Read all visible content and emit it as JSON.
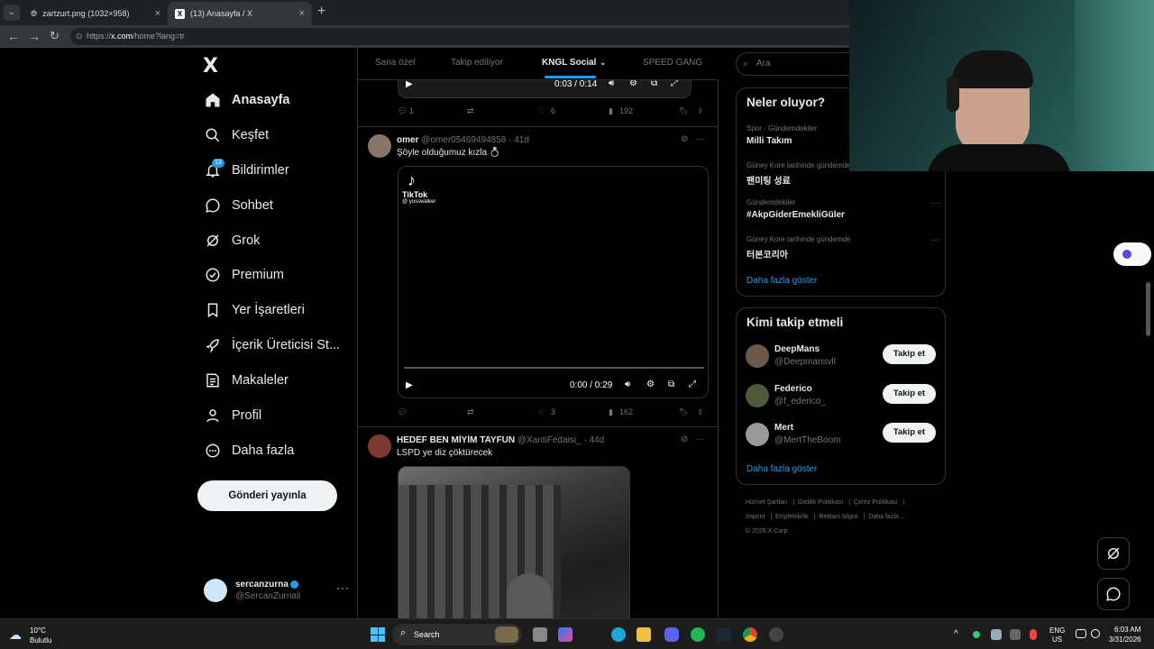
{
  "browser": {
    "tabs": [
      {
        "title": "zartzurt.png (1032×958)",
        "close": "×"
      },
      {
        "title": "(13) Anasayfa / X",
        "close": "×"
      }
    ],
    "new_tab": "+",
    "url_prefix": "https://",
    "url_host": "x.com",
    "url_path": "/home?lang=tr"
  },
  "sidebar": {
    "logo": "X",
    "items": [
      {
        "label": "Anasayfa",
        "icon": "home-icon"
      },
      {
        "label": "Keşfet",
        "icon": "search-icon"
      },
      {
        "label": "Bildirimler",
        "icon": "bell-icon"
      },
      {
        "label": "Sohbet",
        "icon": "chat-icon"
      },
      {
        "label": "Grok",
        "icon": "grok-icon"
      },
      {
        "label": "Premium",
        "icon": "premium-icon"
      },
      {
        "label": "Yer İşaretleri",
        "icon": "bookmark-icon"
      },
      {
        "label": "İçerik Üreticisi St...",
        "icon": "rocket-icon"
      },
      {
        "label": "Makaleler",
        "icon": "article-icon"
      },
      {
        "label": "Profil",
        "icon": "profile-icon"
      },
      {
        "label": "Daha fazla",
        "icon": "more-circle-icon"
      }
    ],
    "notification_count": "13",
    "post_button": "Gönderi yayınla",
    "account": {
      "name": "sercanzurna",
      "handle": "@SercanZurnali",
      "more": "···"
    }
  },
  "feed": {
    "tabs": [
      {
        "label": "Sana özel"
      },
      {
        "label": "Takip ediliyor"
      },
      {
        "label": "KNGL Social",
        "active": true
      },
      {
        "label": "SPEED GANG"
      }
    ],
    "top_video": {
      "time": "0:03 / 0:14"
    },
    "top_actions": {
      "replies": "1",
      "retweets": "",
      "likes": "6",
      "views": "192"
    },
    "tweets": [
      {
        "name": "omer",
        "handle": "@omer05469494858",
        "age": "· 41d",
        "text": "Şöyle olduğumuz kızla 💍",
        "video": {
          "time": "0:00 / 0:29",
          "watermark": "TikTok",
          "watermark_handle": "@ yusswalker"
        },
        "actions": {
          "replies": "",
          "retweets": "",
          "likes": "3",
          "views": "162"
        }
      },
      {
        "name": "HEDEF BEN MİYİM TAYFUN",
        "handle": "@XantiFedaisi_",
        "age": "· 44d",
        "text": "LSPD ye diz çöktürecek"
      }
    ]
  },
  "right": {
    "search_placeholder": "Ara",
    "trends_title": "Neler oluyor?",
    "trends": [
      {
        "category": "Spor · Gündemdekiler",
        "title": "Milli Takım"
      },
      {
        "category": "Güney Kore tarihinde gündemde",
        "title": "팬미팅 성료"
      },
      {
        "category": "Gündemdekiler",
        "title": "#AkpGiderEmekliGüler"
      },
      {
        "category": "Güney Kore tarihinde gündemde",
        "title": "터본코리아"
      }
    ],
    "trends_show_more": "Daha fazla göster",
    "who_title": "Kimi takip etmeli",
    "who": [
      {
        "name": "DeepMans",
        "handle": "@Deepmansvll",
        "button": "Takip et"
      },
      {
        "name": "Federico",
        "handle": "@f_ederico_",
        "button": "Takip et"
      },
      {
        "name": "Mert",
        "handle": "@MertTheBoom",
        "button": "Takip et"
      }
    ],
    "who_show_more": "Daha fazla göster",
    "footer": [
      "Hizmet Şartları",
      "Gizlilik Politikası",
      "Çerez Politikası",
      "Imprint",
      "Erişilebilirlik",
      "Reklam bilgisi",
      "Daha fazla ...",
      "© 2026 X Corp."
    ]
  },
  "taskbar": {
    "weather_temp": "10°C",
    "weather_desc": "Bulutlu",
    "search": "Search",
    "lang1": "ENG",
    "lang2": "US",
    "time": "6:03 AM",
    "date": "3/31/2026"
  },
  "colors": {
    "accent": "#1d9bf0",
    "bg": "#000000",
    "border": "#2f3336",
    "muted": "#71767b"
  }
}
